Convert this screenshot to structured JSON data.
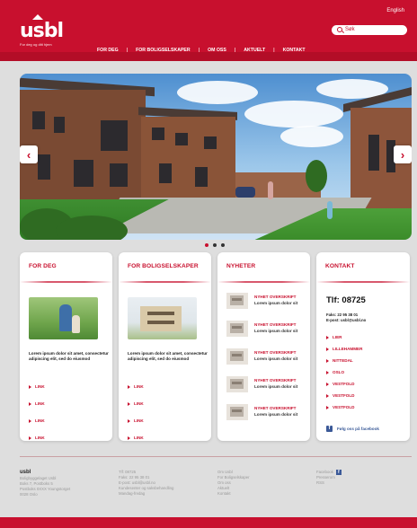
{
  "header": {
    "language_link": "English",
    "search": {
      "placeholder": "Søk"
    },
    "logo": {
      "text": "usbl",
      "tagline": "For deg og ditt hjem"
    },
    "nav": [
      "FOR DEG",
      "FOR BOLIGSELSKAPER",
      "OM OSS",
      "AKTUELT",
      "KONTAKT"
    ],
    "nav_separator": "|"
  },
  "hero": {
    "prev_label": "‹",
    "next_label": "›",
    "slides_count": 3,
    "active_slide": 1
  },
  "cards": {
    "for_deg": {
      "title": "FOR DEG",
      "body": "Lorem ipsum dolor sit amet, consectetur adipiscing elit, sed do eiusmod",
      "links": [
        "LINK",
        "LINK",
        "LINK",
        "LINK"
      ]
    },
    "for_boligselskaper": {
      "title": "FOR BOLIGSELSKAPER",
      "body": "Lorem ipsum dolor sit amet, consectetur adipiscing elit, sed do eiusmod",
      "links": [
        "LINK",
        "LINK",
        "LINK",
        "LINK"
      ]
    },
    "nyheter": {
      "title": "NYHETER",
      "items": [
        {
          "headline": "NYHET OVERSKRIFT",
          "sub": "Lorem ipsum dolor sit"
        },
        {
          "headline": "NYHET OVERSKRIFT",
          "sub": "Lorem ipsum dolor sit"
        },
        {
          "headline": "NYHET OVERSKRIFT",
          "sub": "Lorem ipsum dolor sit"
        },
        {
          "headline": "NYHET OVERSKRIFT",
          "sub": "Lorem ipsum dolor sit"
        },
        {
          "headline": "NYHET OVERSKRIFT",
          "sub": "Lorem ipsum dolor sit"
        }
      ]
    },
    "kontakt": {
      "title": "KONTAKT",
      "phone": "Tlf: 08725",
      "fax": "Faks: 22 95 38 01",
      "email": "E-post: usbl@usbl.no",
      "links": [
        "LIER",
        "LILLEHAMMER",
        "NITTEDAL",
        "OSLO",
        "VESTFOLD",
        "VESTFOLD",
        "VESTFOLD"
      ],
      "facebook": "Følg oss på facebook"
    }
  },
  "footer": {
    "col1": {
      "brand": "usbl",
      "lines": [
        "Boligbyggelaget Usbl",
        "Boks 7, Postboks 5",
        "Postboks 0XXX Youngstorget",
        "0028 Oslo"
      ]
    },
    "col2": {
      "lines": [
        "Tlf: 08725",
        "Faks: 22 95 38 01",
        "E-post: usbl@usbl.no",
        "Kundesenter og saksbehandling",
        "Mandag-fredag"
      ]
    },
    "col3": {
      "lines": [
        "Om Usbl",
        "For Boligselskaper",
        "Om oss",
        "Aktuelt",
        "Kontakt"
      ]
    },
    "col4": {
      "lines": [
        "Facebook",
        "Presserom",
        "RSS"
      ]
    }
  },
  "colors": {
    "brand_red": "#c8102e",
    "background": "#dedede",
    "facebook_blue": "#3b5998"
  }
}
